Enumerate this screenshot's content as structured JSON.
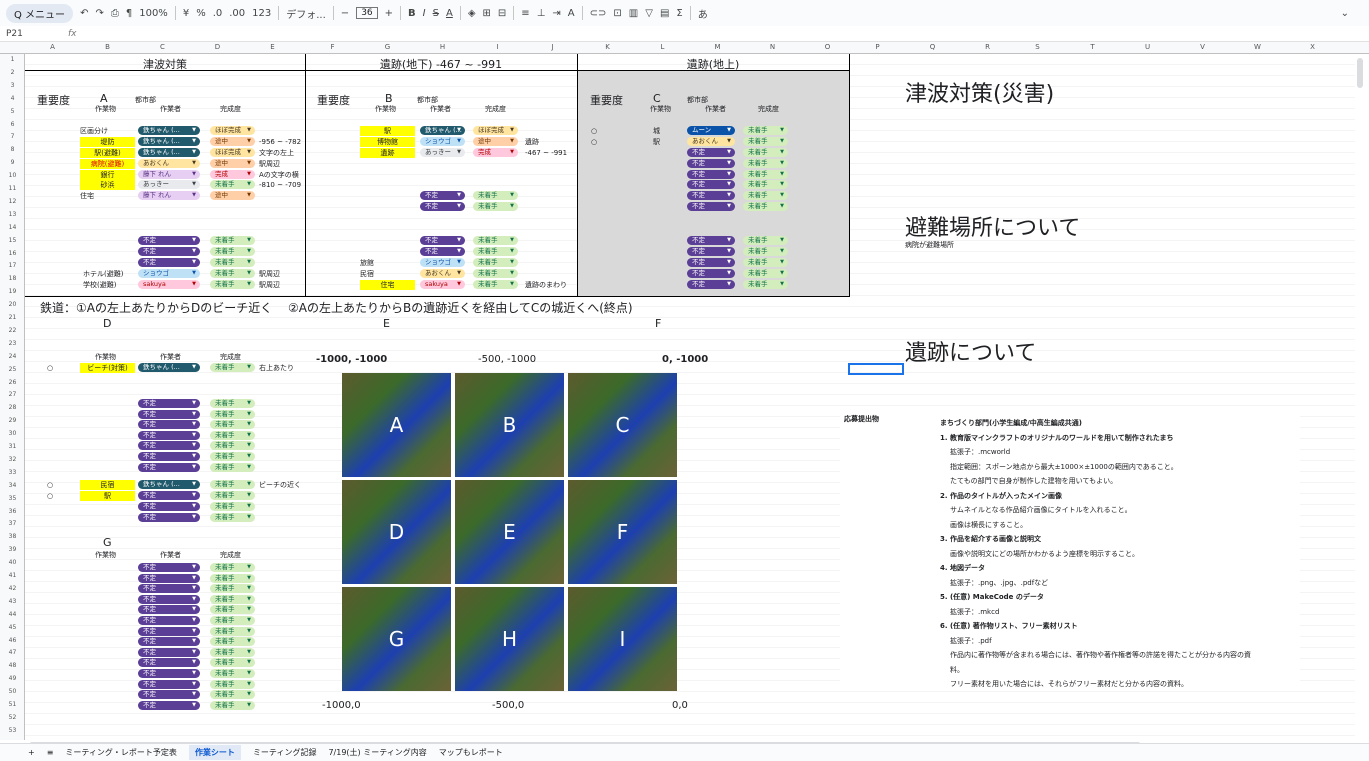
{
  "toolbar": {
    "menu": "Q メニュー",
    "zoom": "100%",
    "font": "デフォ...",
    "size": "36",
    "items": [
      "¥",
      "%",
      ".0",
      ".00",
      "123"
    ]
  },
  "formula": {
    "cell": "P21",
    "fx": "fx"
  },
  "columns": [
    "A",
    "B",
    "C",
    "D",
    "E",
    "F",
    "G",
    "H",
    "I",
    "J",
    "K",
    "L",
    "M",
    "N",
    "O",
    "P",
    "Q",
    "R",
    "S",
    "T",
    "U",
    "V",
    "W",
    "X"
  ],
  "sections": {
    "tsunami": "津波対策",
    "ruins_under": "遺跡(地下)   -467 ~ -991",
    "ruins_above": "遺跡(地上)"
  },
  "labels": {
    "importance": "重要度",
    "area_a": "A",
    "area_b": "B",
    "area_c": "C",
    "dept": "都市部",
    "work": "作業物",
    "worker": "作業者",
    "done": "完成度"
  },
  "table_a": [
    {
      "work": "区画分け",
      "worker": "鉄ちゃん (...",
      "done": "ほぼ完成",
      "note": ""
    },
    {
      "work": "堤防",
      "worker": "鉄ちゃん (...",
      "done": "途中",
      "note": "-956 ~ -782"
    },
    {
      "work": "駅(避難)",
      "worker": "鉄ちゃん (...",
      "done": "ほぼ完成",
      "note": "文字の左上"
    },
    {
      "work": "病院(避難)",
      "worker": "あおくん",
      "done": "途中",
      "note": "駅周辺"
    },
    {
      "work": "銀行",
      "worker": "藤下 れん",
      "done": "完成",
      "note": "Aの文字の横"
    },
    {
      "work": "砂浜",
      "worker": "あっきー",
      "done": "未着手",
      "note": "-810 ~ -709"
    },
    {
      "work": "住宅",
      "worker": "藤下 れん",
      "done": "途中",
      "note": ""
    }
  ],
  "table_b": [
    {
      "work": "駅",
      "worker": "鉄ちゃん (...",
      "done": "ほぼ完成",
      "note": ""
    },
    {
      "work": "博物館",
      "worker": "ショウゴ",
      "done": "途中",
      "note": "遺跡"
    },
    {
      "work": "遺跡",
      "worker": "あっきー",
      "done": "完成",
      "note": "-467 ~ -991"
    }
  ],
  "table_c": [
    {
      "imp": "○",
      "work": "城",
      "worker": "ムーン",
      "done": "未着手"
    },
    {
      "imp": "○",
      "work": "駅",
      "worker": "あおくん",
      "done": "未着手"
    }
  ],
  "lower_a": [
    {
      "work": "ホテル(避難)",
      "worker": "ショウゴ",
      "done": "未着手",
      "note": "駅周辺"
    },
    {
      "work": "学校(避難)",
      "worker": "sakuya",
      "done": "未着手",
      "note": "駅周辺"
    }
  ],
  "lower_b": [
    {
      "work": "旅館",
      "worker": "ショウゴ",
      "done": "未着手",
      "note": ""
    },
    {
      "work": "民宿",
      "worker": "あおくん",
      "done": "未着手",
      "note": ""
    },
    {
      "work": "住宅",
      "worker": "sakuya",
      "done": "未着手",
      "note": "遺跡のまわり"
    }
  ],
  "chip_undecided": "不定",
  "chip_notstarted": "未着手",
  "railway": "鉄道：①Aの左上あたりからDのビーチ近く　 ②Aの左上あたりからBの遺跡近くを経由してCの城近くへ(終点)",
  "area_d": "D",
  "area_e": "E",
  "area_f": "F",
  "area_g": "G",
  "table_d": [
    {
      "imp": "○",
      "work": "ビーチ(対策)",
      "worker": "鉄ちゃん (...",
      "done": "未着手",
      "note": "右上あたり"
    },
    {
      "imp": "○",
      "work": "民宿",
      "worker": "鉄ちゃん (...",
      "done": "未着手",
      "note": "ビーチの近く"
    },
    {
      "imp": "○",
      "work": "駅",
      "worker": "不定",
      "done": "未着手",
      "note": ""
    }
  ],
  "map": {
    "tl": "-1000, -1000",
    "tm": "-500, -1000",
    "tr": "0, -1000",
    "bl": "-1000,0",
    "bm": "-500,0",
    "br": "0,0",
    "tiles": [
      "A",
      "B",
      "C",
      "D",
      "E",
      "F",
      "G",
      "H",
      "I"
    ]
  },
  "headings": {
    "tsunami": "津波対策(災害)",
    "evac": "避難場所について",
    "evac_note": "病院が避難場所",
    "ruins": "遺跡について"
  },
  "submission": {
    "label": "応募提出物",
    "lines": [
      "まちづくり部門(小学生編成/中高生編成共通)",
      "1. 教育版マインクラフトのオリジナルのワールドを用いて制作されたまち",
      "拡張子：.mcworld",
      "指定範囲：スポーン地点から最大±1000×±1000の範囲内であること。",
      "たてもの部門で自身が制作した建物を用いてもよい。",
      "2. 作品のタイトルが入ったメイン画像",
      "サムネイルとなる作品紹介画像にタイトルを入れること。",
      "画像は横長にすること。",
      "3. 作品を紹介する画像と説明文",
      "画像や説明文にどの場所かわかるよう座標を明示すること。",
      "4. 地図データ",
      "拡張子：.png、.jpg、.pdfなど",
      "5. (任意) MakeCode のデータ",
      "拡張子：.mkcd",
      "6. (任意) 著作物リスト、フリー素材リスト",
      "拡張子：.pdf",
      "作品内に著作物等が含まれる場合には、著作物や著作権者等の許諾を得たことが分かる内容の資",
      "料。",
      "フリー素材を用いた場合には、それらがフリー素材だと分かる内容の資料。"
    ]
  },
  "tabs": [
    "ミーティング・レポート予定表",
    "作業シート",
    "ミーティング記録",
    "7/19(土) ミーティング内容",
    "マップもレポート"
  ]
}
